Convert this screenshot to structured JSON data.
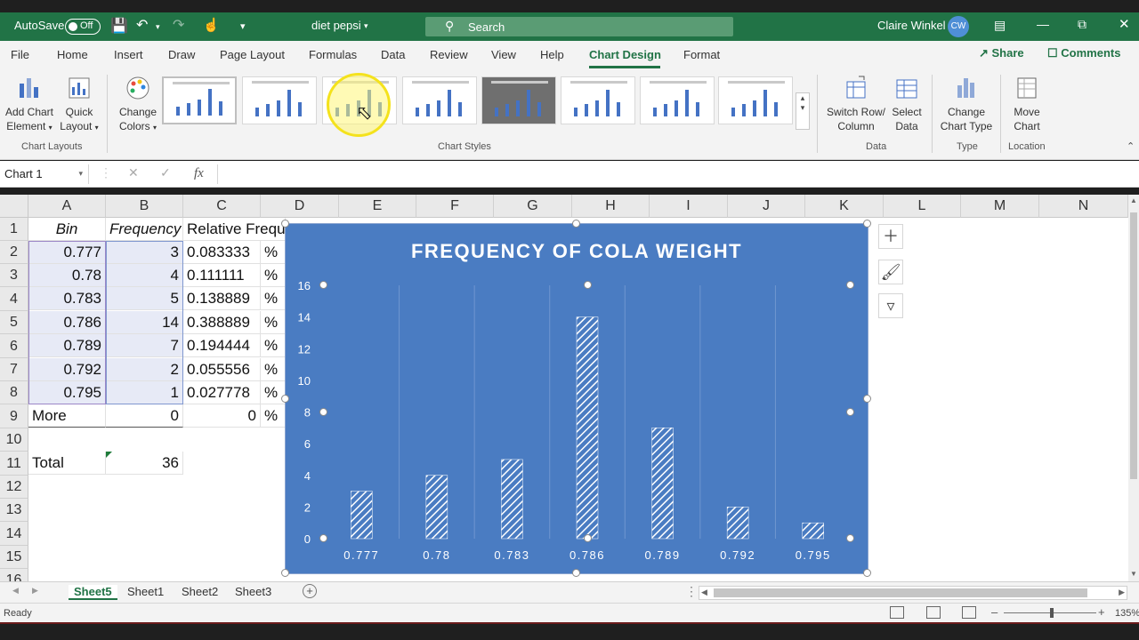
{
  "titlebar": {
    "autosave_label": "AutoSave",
    "autosave_state": "Off",
    "document_name": "diet pepsi",
    "search_placeholder": "Search",
    "user_name": "Claire Winkel",
    "user_initials": "CW"
  },
  "ribbon_tabs": [
    "File",
    "Home",
    "Insert",
    "Draw",
    "Page Layout",
    "Formulas",
    "Data",
    "Review",
    "View",
    "Help",
    "Chart Design",
    "Format"
  ],
  "active_tab": "Chart Design",
  "share_label": "Share",
  "comments_label": "Comments",
  "ribbon": {
    "add_chart_element": "Add Chart Element",
    "add_chart_element_l1": "Add Chart",
    "add_chart_element_l2": "Element",
    "quick_layout_l1": "Quick",
    "quick_layout_l2": "Layout",
    "change_colors_l1": "Change",
    "change_colors_l2": "Colors",
    "group_chart_layouts": "Chart Layouts",
    "group_chart_styles": "Chart Styles",
    "switch_rowcol_l1": "Switch Row/",
    "switch_rowcol_l2": "Column",
    "select_data_l1": "Select",
    "select_data_l2": "Data",
    "group_data": "Data",
    "change_chart_type_l1": "Change",
    "change_chart_type_l2": "Chart Type",
    "group_type": "Type",
    "move_chart_l1": "Move",
    "move_chart_l2": "Chart",
    "group_location": "Location"
  },
  "formula_bar": {
    "name_box": "Chart 1",
    "fx": "fx",
    "content": ""
  },
  "columns": [
    "A",
    "B",
    "C",
    "D",
    "E",
    "F",
    "G",
    "H",
    "I",
    "J",
    "K",
    "L",
    "M",
    "N"
  ],
  "rows": [
    "1",
    "2",
    "3",
    "4",
    "5",
    "6",
    "7",
    "8",
    "9",
    "10",
    "11",
    "12",
    "13",
    "14",
    "15",
    "16"
  ],
  "table": {
    "header_bin": "Bin",
    "header_frequency": "Frequency",
    "header_relative": "Relative Frequ",
    "bins": [
      "0.777",
      "0.78",
      "0.783",
      "0.786",
      "0.789",
      "0.792",
      "0.795",
      "More"
    ],
    "frequencies": [
      "3",
      "4",
      "5",
      "14",
      "7",
      "2",
      "1",
      "0"
    ],
    "relative": [
      "0.083333",
      "0.111111",
      "0.138889",
      "0.388889",
      "0.194444",
      "0.055556",
      "0.027778",
      "0"
    ],
    "percent_suffix": "%",
    "total_label": "Total",
    "total_value": "36"
  },
  "chart_data": {
    "type": "bar",
    "title": "FREQUENCY OF COLA WEIGHT",
    "categories": [
      "0.777",
      "0.78",
      "0.783",
      "0.786",
      "0.789",
      "0.792",
      "0.795"
    ],
    "values": [
      3,
      4,
      5,
      14,
      7,
      2,
      1
    ],
    "xlabel": "",
    "ylabel": "",
    "ylim": [
      0,
      16
    ],
    "yticks": [
      0,
      2,
      4,
      6,
      8,
      10,
      12,
      14,
      16
    ],
    "grid": "vertical lines",
    "background_color": "#4a7cc2",
    "bar_fill": "white diagonal hatch"
  },
  "sheets": [
    "Sheet5",
    "Sheet1",
    "Sheet2",
    "Sheet3"
  ],
  "active_sheet": "Sheet5",
  "status": {
    "ready": "Ready",
    "zoom": "135%"
  },
  "colors": {
    "excel_green": "#217346",
    "chart_bg": "#4a7cc2"
  }
}
